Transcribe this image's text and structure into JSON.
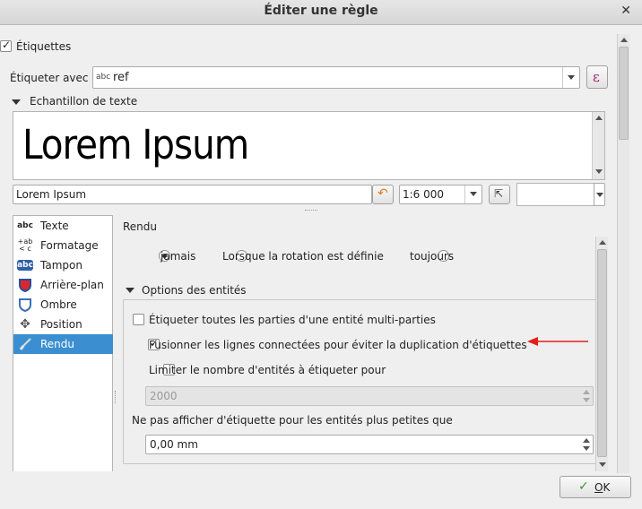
{
  "window": {
    "title": "Éditer une règle",
    "close_glyph": "✕"
  },
  "labels_checkbox": {
    "label": "Étiquettes",
    "checked": true
  },
  "label_with": {
    "label": "Étiqueter avec",
    "field_badge": "abc",
    "field_value": "ref",
    "expression_glyph": "ε"
  },
  "sample": {
    "header": "Echantillon de texte",
    "preview_text": "Lorem Ipsum",
    "input_value": "Lorem Ipsum",
    "scale_value": "1:6 000"
  },
  "sidebar": {
    "items": [
      {
        "label": "Texte",
        "icon": "text-abc-icon",
        "glyph": "abc"
      },
      {
        "label": "Formatage",
        "icon": "formatting-icon",
        "glyph": "+ab\n< c"
      },
      {
        "label": "Tampon",
        "icon": "buffer-abc-icon",
        "glyph": "abc"
      },
      {
        "label": "Arrière-plan",
        "icon": "background-shield-icon",
        "glyph": ""
      },
      {
        "label": "Ombre",
        "icon": "shadow-icon",
        "glyph": ""
      },
      {
        "label": "Position",
        "icon": "position-icon",
        "glyph": "✥"
      },
      {
        "label": "Rendu",
        "icon": "rendering-brush-icon",
        "glyph": ""
      }
    ],
    "selected": "Rendu"
  },
  "rendu": {
    "heading": "Rendu",
    "radio_options": [
      "jamais",
      "Lorsque la rotation est définie",
      "toujours"
    ],
    "radio_selected": "jamais",
    "group_title": "Options des entités",
    "opt_multipart": {
      "label": "Étiqueter toutes les parties d'une entité multi-parties",
      "checked": false
    },
    "opt_merge": {
      "label": "Fusionner les lignes connectées pour éviter la duplication d'étiquettes",
      "checked": true
    },
    "opt_limit": {
      "label": "Limiter le nombre d'entités à étiqueter pour",
      "checked": false
    },
    "limit_value": "2000",
    "min_size_label": "Ne pas afficher d'étiquette pour les entités plus petites que",
    "min_size_value": "0,00 mm"
  },
  "ok_button": {
    "label": "OK",
    "underline_char": "O",
    "rest": "K",
    "icon": "check-icon"
  },
  "colors": {
    "selection": "#3b8fd0",
    "arrow": "#e0201b"
  }
}
